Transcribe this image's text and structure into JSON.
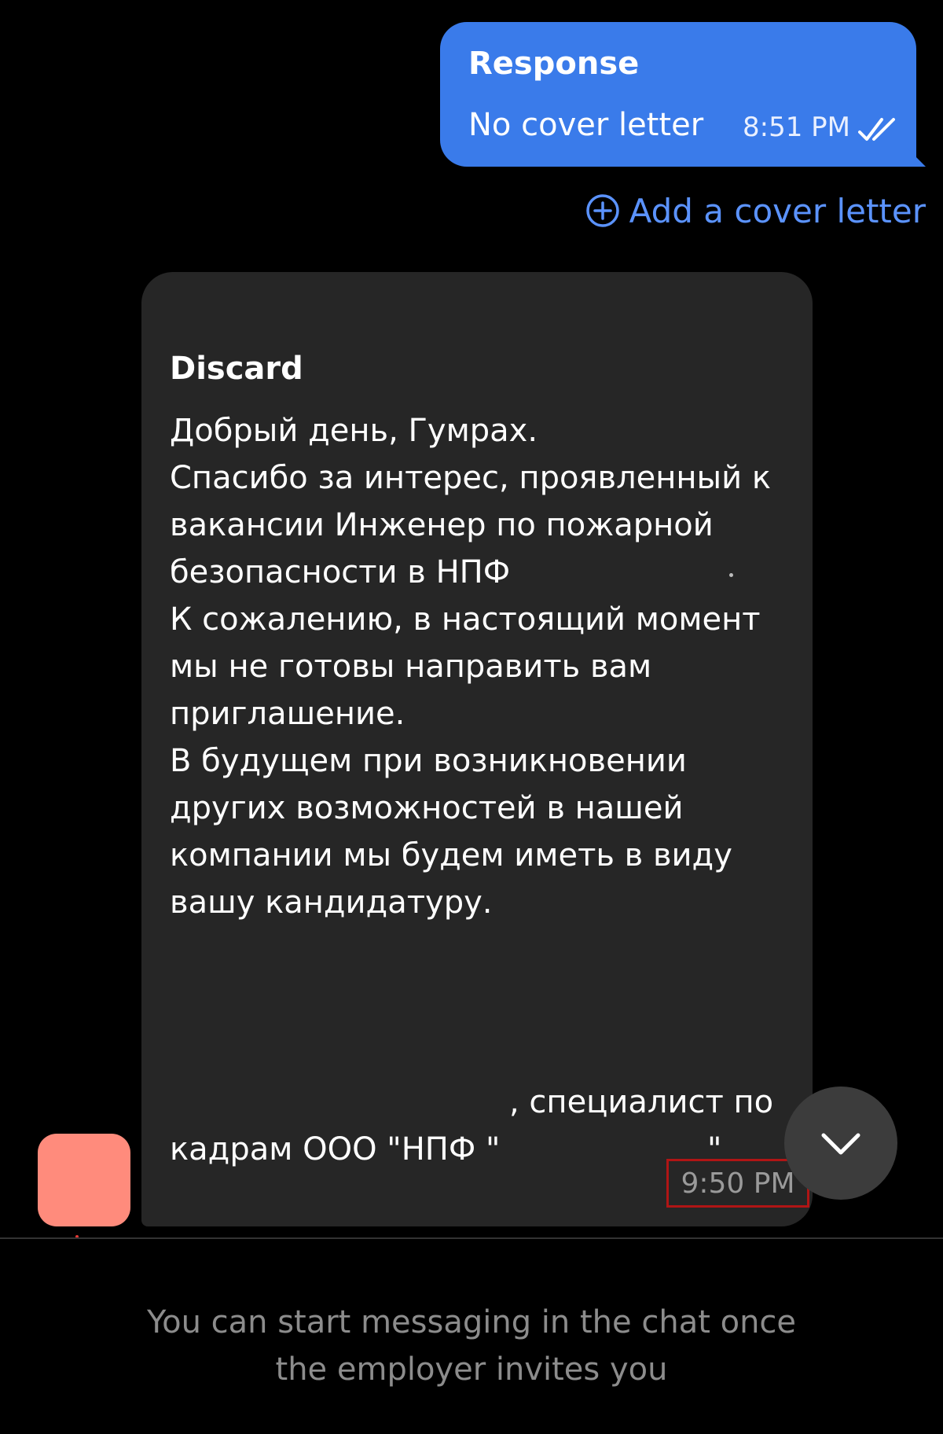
{
  "sent_message": {
    "title": "Response",
    "text": "No cover letter",
    "time": "8:51 PM",
    "status_icon": "double-check-icon"
  },
  "add_cover_letter": {
    "label": "Add a cover letter",
    "icon": "plus-circle-icon"
  },
  "received_message": {
    "title": "Discard",
    "lines": [
      "Добрый день, Гумрах.",
      "Спасибо за интерес, проявленный к вакансии Инженер по пожарной безопасности в НПФ",
      "К сожалению, в настоящий момент мы не готовы направить вам приглашение.",
      "В будущем при возникновении других возможностей в нашей компании мы будем иметь в виду вашу кандидатуру."
    ],
    "signature_line1": ", специалист по",
    "signature_line2": "кадрам ООО \"НПФ \"",
    "signature_line2_end": "\"",
    "time": "9:50 PM"
  },
  "scroll_down": {
    "icon": "chevron-down-icon"
  },
  "footer": {
    "line1": "You can start messaging in the chat once",
    "line2": "the employer invites you"
  },
  "colors": {
    "background": "#000000",
    "sent_bubble": "#3a7bea",
    "received_bubble": "#262626",
    "link": "#5b93ff",
    "avatar": "#ff8b7c",
    "highlight_border": "#b01515"
  }
}
